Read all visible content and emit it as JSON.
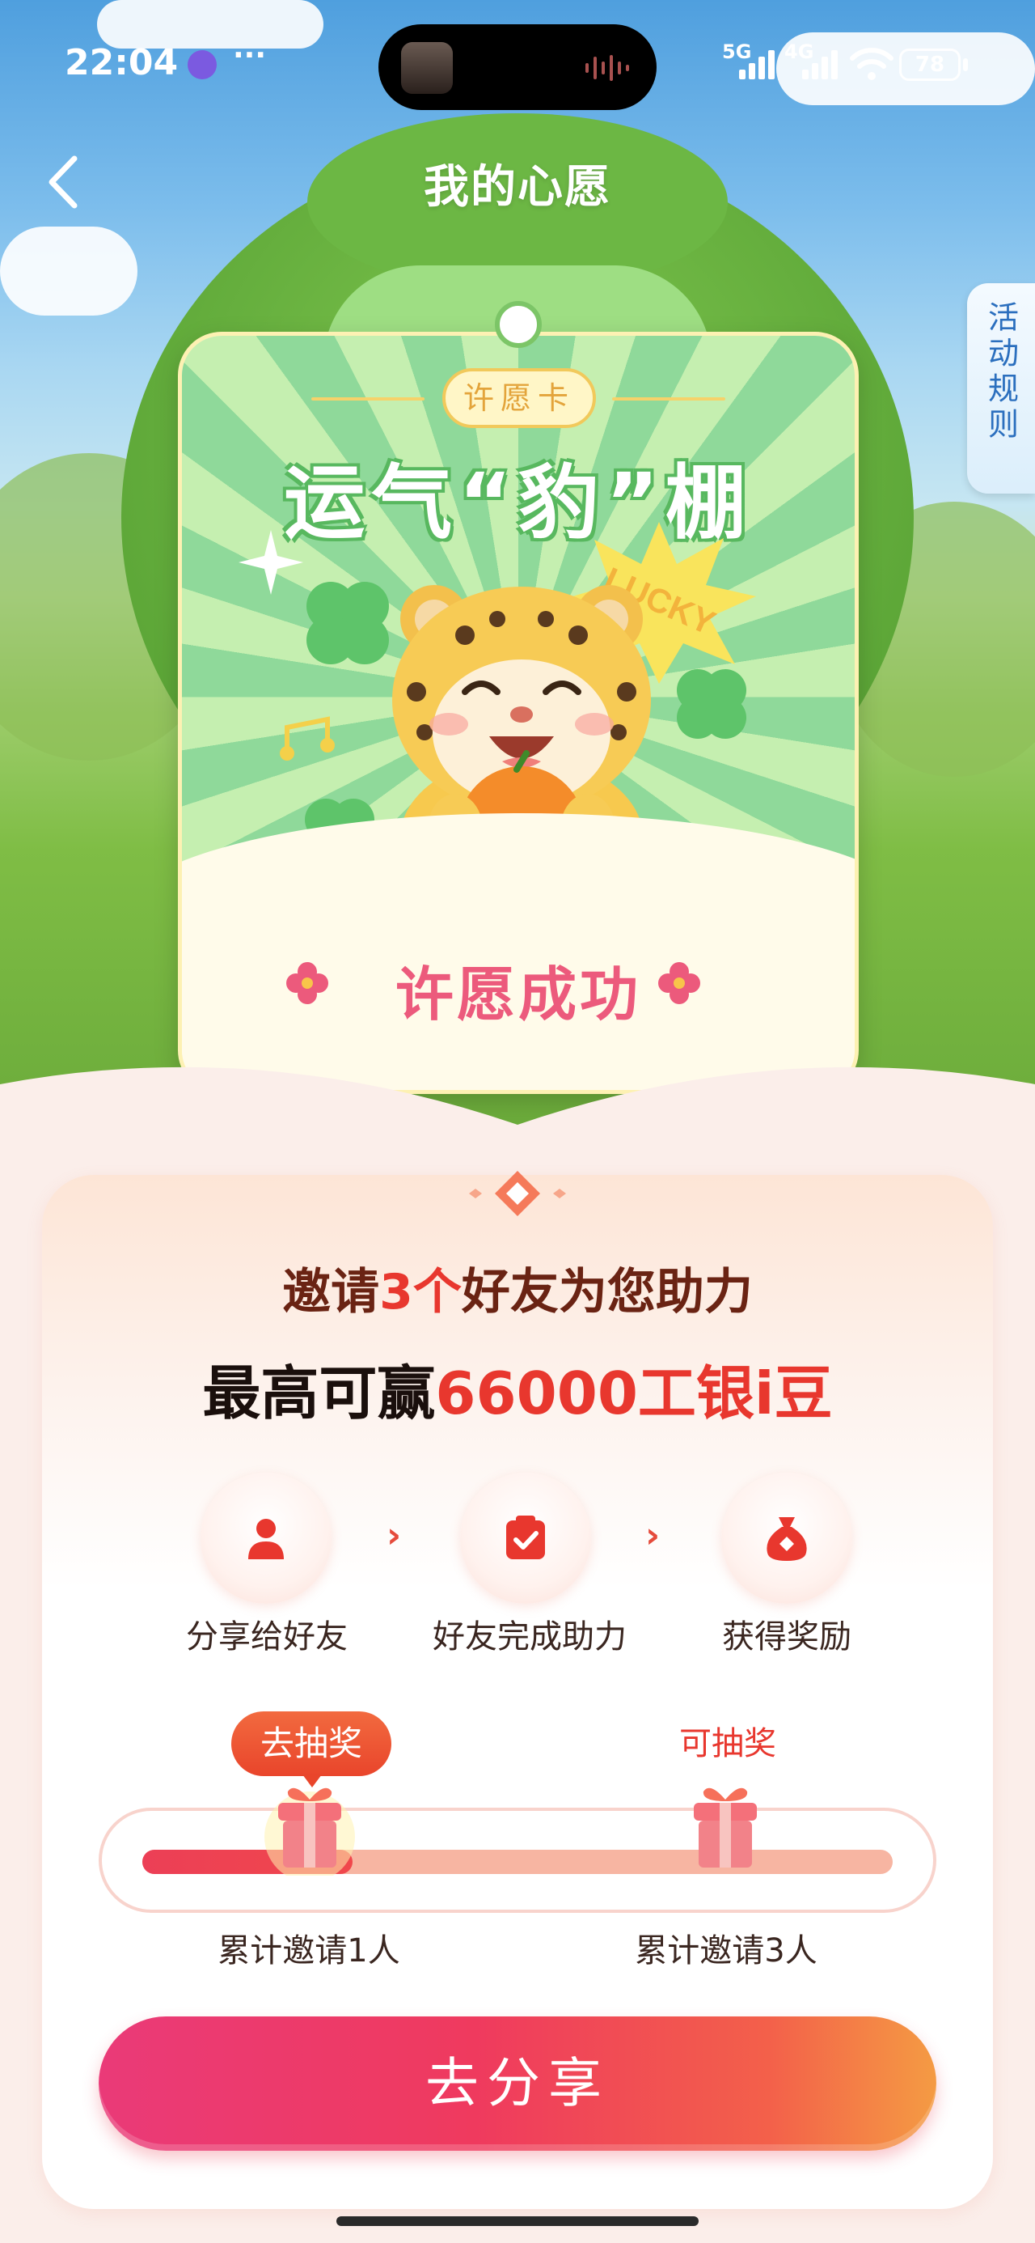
{
  "status_bar": {
    "time": "22:04",
    "more": "···",
    "network_5g": "5G",
    "network_4g": "4G",
    "battery": "78"
  },
  "header": {
    "title": "我的心愿",
    "rules_tab": "活动规则"
  },
  "wish_card": {
    "badge": "许愿卡",
    "headline": "运气“豹”棚",
    "lucky_stamp": "LUCKY",
    "status": "许愿成功"
  },
  "invite": {
    "line_prefix": "邀请",
    "line_count": "3个",
    "line_suffix": "好友为您助力",
    "reward_prefix": "最高可赢",
    "reward_amount": "66000工银i豆"
  },
  "steps": [
    {
      "label": "分享给好友",
      "icon": "user-icon"
    },
    {
      "label": "好友完成助力",
      "icon": "clipboard-check-icon"
    },
    {
      "label": "获得奖励",
      "icon": "money-bag-icon"
    }
  ],
  "progress": {
    "fill_fraction": 0.28,
    "milestones": [
      {
        "label": "累计邀请1人",
        "action": "去抽奖"
      },
      {
        "label": "累计邀请3人",
        "action": "可抽奖"
      }
    ]
  },
  "share_button": "去分享",
  "colors": {
    "accent_red": "#e8372e",
    "share_gradient_start": "#ea3a78",
    "share_gradient_end": "#f49b43",
    "card_green": "#8fd99a"
  }
}
